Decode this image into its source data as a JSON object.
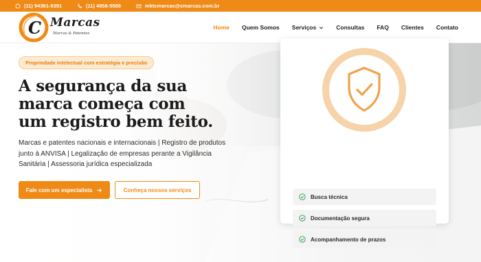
{
  "topbar": {
    "whatsapp": "(11) 94361-8391",
    "phone": "(11) 4858-5588",
    "email": "mktcmarcas@cmarcas.com.br"
  },
  "logo": {
    "letter": "C",
    "word": "Marcas",
    "tagline": "Marcas & Patentes"
  },
  "nav": {
    "items": [
      {
        "label": "Home",
        "active": true
      },
      {
        "label": "Quem Somos"
      },
      {
        "label": "Serviços",
        "has_dropdown": true
      },
      {
        "label": "Consultas"
      },
      {
        "label": "FAQ"
      },
      {
        "label": "Clientes"
      },
      {
        "label": "Contato"
      }
    ]
  },
  "hero": {
    "badge": "Propriedade intelectual com estratégia e precisão",
    "headline_1": "A segurança da sua",
    "headline_2": "marca começa com",
    "headline_3": "um registro bem feito.",
    "desc_1": "Marcas e patentes nacionais e internacionais | Registro de produtos",
    "desc_2": "junto à ANVISA | Legalização de empresas perante a Vigilância",
    "desc_3": "Sanitária | Assessoria jurídica especializada",
    "primary_cta": "Fale com um especialista",
    "secondary_cta": "Conheça nossos serviços"
  },
  "card": {
    "features": [
      "Busca técnica",
      "Documentação segura",
      "Acompanhamento de prazos"
    ]
  },
  "colors": {
    "accent": "#f08a16",
    "badge_bg": "#fcebd3",
    "check": "#3aa35a",
    "dark_text": "#1c1c1c"
  },
  "icons": {
    "whatsapp": "whatsapp-icon",
    "phone": "phone-icon",
    "email": "mail-icon",
    "shield": "shield-check-icon",
    "check": "check-circle-icon",
    "arrow": "arrow-right-icon",
    "chevron": "chevron-down-icon"
  }
}
